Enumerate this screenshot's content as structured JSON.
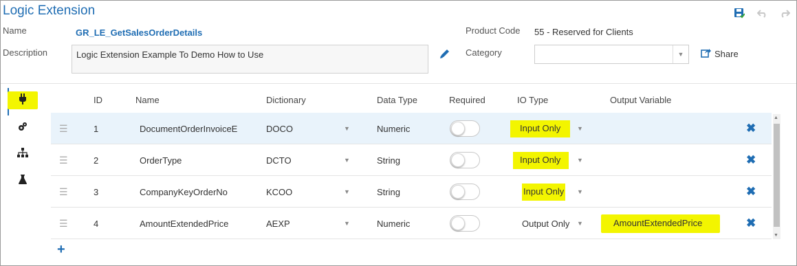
{
  "app": {
    "title": "Logic Extension"
  },
  "form": {
    "name_label": "Name",
    "name_value": "GR_LE_GetSalesOrderDetails",
    "description_label": "Description",
    "description_value": "Logic Extension Example To Demo How to Use",
    "product_code_label": "Product Code",
    "product_code_value": "55 - Reserved for Clients",
    "category_label": "Category",
    "category_value": "",
    "share_label": "Share"
  },
  "toolbar": {
    "icons": [
      "save-icon",
      "undo-icon",
      "redo-icon"
    ]
  },
  "side_tabs": [
    "plug-icon",
    "gears-icon",
    "hierarchy-icon",
    "flask-icon"
  ],
  "table": {
    "headers": {
      "id": "ID",
      "name": "Name",
      "dictionary": "Dictionary",
      "data_type": "Data Type",
      "required": "Required",
      "io_type": "IO Type",
      "output_variable": "Output Variable"
    },
    "rows": [
      {
        "id": "1",
        "name": "DocumentOrderInvoiceE",
        "dictionary": "DOCO",
        "data_type": "Numeric",
        "required": false,
        "io_type": "Input Only",
        "output_variable": ""
      },
      {
        "id": "2",
        "name": "OrderType",
        "dictionary": "DCTO",
        "data_type": "String",
        "required": false,
        "io_type": "Input Only",
        "output_variable": ""
      },
      {
        "id": "3",
        "name": "CompanyKeyOrderNo",
        "dictionary": "KCOO",
        "data_type": "String",
        "required": false,
        "io_type": "Input Only",
        "output_variable": ""
      },
      {
        "id": "4",
        "name": "AmountExtendedPrice",
        "dictionary": "AEXP",
        "data_type": "Numeric",
        "required": false,
        "io_type": "Output Only",
        "output_variable": "AmountExtendedPrice"
      }
    ]
  },
  "colors": {
    "accent": "#1f6db3",
    "highlight": "#f3f500",
    "selected_row": "#e9f3fb"
  }
}
